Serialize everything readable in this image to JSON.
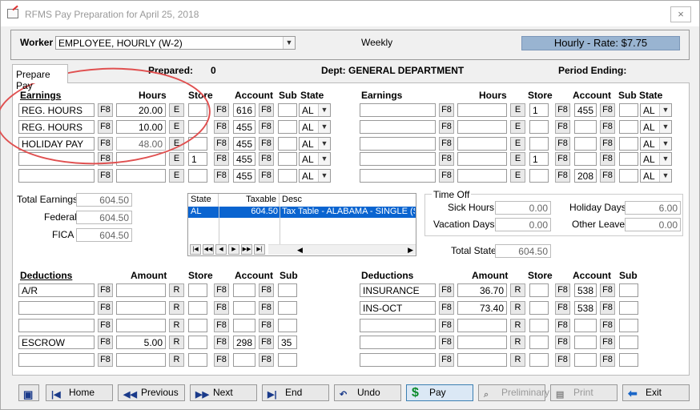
{
  "window": {
    "title": "RFMS Pay Preparation for April 25, 2018",
    "close": "×"
  },
  "header": {
    "worker_label": "Worker",
    "worker_value": "EMPLOYEE, HOURLY (W-2)",
    "frequency": "Weekly",
    "rate": "Hourly - Rate: $7.75",
    "tab": "Prepare Pay",
    "prepared_label": "Prepared:",
    "prepared_value": "0",
    "dept": "Dept: GENERAL DEPARTMENT",
    "period": "Period Ending:"
  },
  "columns": {
    "earnings": "Earnings",
    "hours": "Hours",
    "store": "Store",
    "account": "Account",
    "sub": "Sub",
    "state": "State",
    "deductions": "Deductions",
    "amount": "Amount"
  },
  "btn": {
    "f8": "F8",
    "e": "E",
    "r": "R"
  },
  "earnings_left": [
    {
      "code": "REG. HOURS",
      "hours": "20.00",
      "store": "",
      "account": "616",
      "sub": "",
      "state": "AL"
    },
    {
      "code": "REG. HOURS",
      "hours": "10.00",
      "store": "",
      "account": "455",
      "sub": "",
      "state": "AL"
    },
    {
      "code": "HOLIDAY PAY",
      "hours": "48.00",
      "store": "",
      "account": "455",
      "sub": "",
      "state": "AL"
    },
    {
      "code": "",
      "hours": "",
      "store": "1",
      "account": "455",
      "sub": "",
      "state": "AL"
    },
    {
      "code": "",
      "hours": "",
      "store": "",
      "account": "455",
      "sub": "",
      "state": "AL"
    }
  ],
  "earnings_right": [
    {
      "code": "",
      "hours": "",
      "store": "1",
      "account": "455",
      "sub": "",
      "state": "AL"
    },
    {
      "code": "",
      "hours": "",
      "store": "",
      "account": "",
      "sub": "",
      "state": "AL"
    },
    {
      "code": "",
      "hours": "",
      "store": "",
      "account": "",
      "sub": "",
      "state": "AL"
    },
    {
      "code": "",
      "hours": "",
      "store": "1",
      "account": "",
      "sub": "",
      "state": "AL"
    },
    {
      "code": "",
      "hours": "",
      "store": "",
      "account": "208",
      "sub": "",
      "state": "AL"
    }
  ],
  "totals": {
    "total_earnings_label": "Total Earnings",
    "total_earnings": "604.50",
    "federal_label": "Federal",
    "federal": "604.50",
    "fica_label": "FICA",
    "fica": "604.50",
    "total_state_label": "Total State",
    "total_state": "604.50"
  },
  "state_grid": {
    "headers": [
      "State",
      "Taxable",
      "Desc"
    ],
    "row": {
      "state": "AL",
      "taxable": "604.50",
      "desc": "Tax Table - ALABAMA - SINGLE (S"
    },
    "nav": [
      "|◀",
      "◀◀",
      "◀",
      "▶",
      "▶▶",
      "▶|"
    ]
  },
  "time_off": {
    "title": "Time Off",
    "sick_label": "Sick Hours",
    "sick": "0.00",
    "vacation_label": "Vacation Days",
    "vacation": "0.00",
    "holiday_label": "Holiday Days",
    "holiday": "6.00",
    "other_label": "Other Leave",
    "other": "0.00"
  },
  "deductions_left": [
    {
      "code": "A/R",
      "amount": "",
      "store": "",
      "account": "",
      "sub": ""
    },
    {
      "code": "",
      "amount": "",
      "store": "",
      "account": "",
      "sub": ""
    },
    {
      "code": "",
      "amount": "",
      "store": "",
      "account": "",
      "sub": ""
    },
    {
      "code": "ESCROW",
      "amount": "5.00",
      "store": "",
      "account": "298",
      "sub": "35"
    },
    {
      "code": "",
      "amount": "",
      "store": "",
      "account": "",
      "sub": ""
    }
  ],
  "deductions_right": [
    {
      "code": "INSURANCE",
      "amount": "36.70",
      "store": "",
      "account": "538",
      "sub": ""
    },
    {
      "code": "INS-OCT",
      "amount": "73.40",
      "store": "",
      "account": "538",
      "sub": ""
    },
    {
      "code": "",
      "amount": "",
      "store": "",
      "account": "",
      "sub": ""
    },
    {
      "code": "",
      "amount": "",
      "store": "",
      "account": "",
      "sub": ""
    },
    {
      "code": "",
      "amount": "",
      "store": "",
      "account": "",
      "sub": ""
    }
  ],
  "toolbar": {
    "home": "Home",
    "previous": "Previous",
    "next": "Next",
    "end": "End",
    "undo": "Undo",
    "pay": "Pay",
    "preliminary": "Preliminary",
    "print": "Print",
    "exit": "Exit"
  }
}
